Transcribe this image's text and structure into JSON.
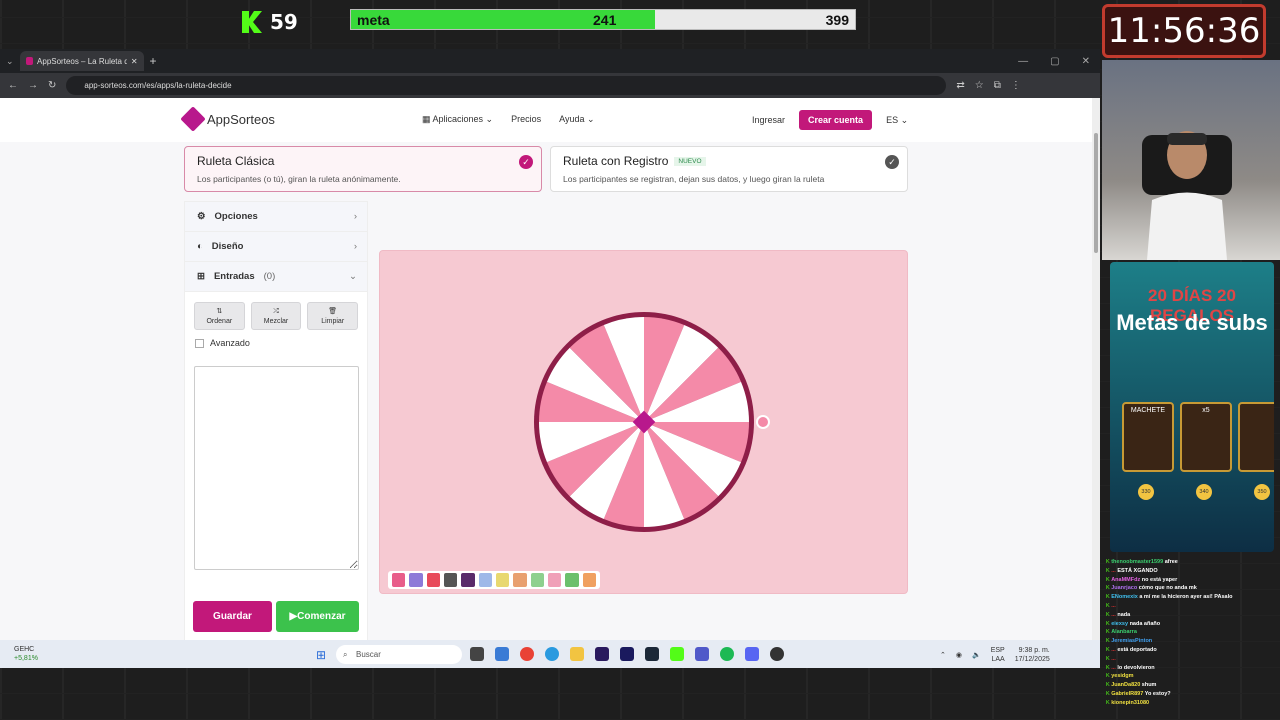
{
  "stream": {
    "viewer_count": "59",
    "goal_label": "meta",
    "goal_current": "241",
    "goal_target": "399",
    "goal_progress": 0.604,
    "clock": "11:56:36"
  },
  "browser": {
    "tab_title": "AppSorteos – La Ruleta de la Su",
    "url": "app-sorteos.com/es/apps/la-ruleta-decide"
  },
  "site": {
    "brand": "AppSorteos",
    "nav": [
      "Aplicaciones",
      "Precios",
      "Ayuda"
    ],
    "login": "Ingresar",
    "create": "Crear cuenta",
    "lang": "ES"
  },
  "modes": [
    {
      "title": "Ruleta Clásica",
      "desc": "Los participantes (o tú), giran la ruleta anónimamente."
    },
    {
      "title": "Ruleta con Registro",
      "badge": "NUEVO",
      "desc": "Los participantes se registran, dejan sus datos, y luego giran la ruleta"
    }
  ],
  "sidebar": {
    "options": "Opciones",
    "design": "Diseño",
    "entries": "Entradas",
    "entries_count": "(0)",
    "tools": [
      "Ordenar",
      "Mezclar",
      "Limpiar"
    ],
    "advanced": "Avanzado"
  },
  "actions": {
    "save": "Guardar",
    "start": "Comenzar"
  },
  "wheel": {
    "segments": 16,
    "colors": [
      "#f48aa8",
      "#ffffff"
    ],
    "rim": "#8e1e48"
  },
  "swatch_colors": [
    "#e85d8a",
    "#8e7ad8",
    "#e84a5a",
    "#555",
    "#5a2a6a",
    "#9fb8e8",
    "#e8d870",
    "#e8a070",
    "#8ed08e",
    "#f0a0b8",
    "#6cc06c",
    "#f0a060"
  ],
  "taskbar": {
    "ticker": "GEHC",
    "ticker_change": "+5,81%",
    "search": "Buscar",
    "lang1": "ESP",
    "lang2": "LAA",
    "time": "9:38 p. m.",
    "date": "17/12/2025"
  },
  "promo": {
    "line1": "20 DÍAS 20 REGALOS",
    "line2": "Metas de subs",
    "card1": "MACHETE",
    "card2": "x5",
    "coins": [
      "330",
      "340",
      "350"
    ]
  },
  "chat": [
    {
      "u": "thenoobmaster1599",
      "m": "afree",
      "c": "#3cd070"
    },
    {
      "u": "...",
      "m": "ESTÁ XGANDO",
      "c": "#e03030"
    },
    {
      "u": "AnaMMFdz",
      "m": "no está yaper",
      "c": "#e060e0"
    },
    {
      "u": "Juanrjaco",
      "m": "cómo que no anda mk",
      "c": "#b070f0"
    },
    {
      "u": "ENomexix",
      "m": "a mí me la hicieron ayer así! PAsalo",
      "c": "#40c0f0"
    },
    {
      "u": "...",
      "m": "",
      "c": "#e03030"
    },
    {
      "u": "...",
      "m": "nada",
      "c": "#e03030"
    },
    {
      "u": "eiexsy",
      "m": "nada añaño",
      "c": "#40c0f0"
    },
    {
      "u": "Alanbarra",
      "m": "",
      "c": "#3cd070"
    },
    {
      "u": "JeremiasPinton",
      "m": "",
      "c": "#40a0f0"
    },
    {
      "u": "...",
      "m": "está deportado",
      "c": "#e03030"
    },
    {
      "u": "...",
      "m": "",
      "c": "#e03030"
    },
    {
      "u": "...",
      "m": "lo devolvieron",
      "c": "#e03030"
    },
    {
      "u": "yesidgm",
      "m": "",
      "c": "#f0e040"
    },
    {
      "u": "JuanDa820",
      "m": "shum",
      "c": "#f0e040"
    },
    {
      "u": "GabrielR897",
      "m": "Yo estoy?",
      "c": "#f0e040"
    },
    {
      "u": "kionepin31080",
      "m": "",
      "c": "#f0e040"
    }
  ]
}
